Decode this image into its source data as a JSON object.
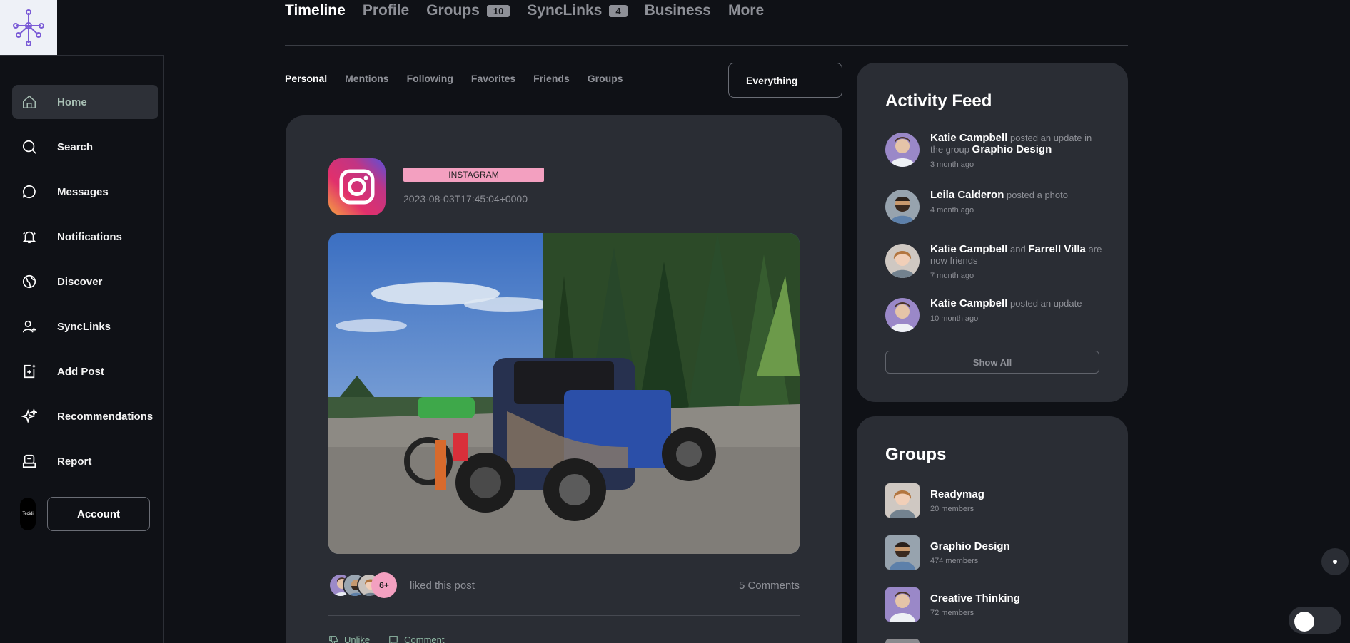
{
  "sidebar": {
    "items": [
      {
        "label": "Home",
        "icon": "home-icon"
      },
      {
        "label": "Search",
        "icon": "search-icon"
      },
      {
        "label": "Messages",
        "icon": "message-icon"
      },
      {
        "label": "Notifications",
        "icon": "bell-icon"
      },
      {
        "label": "Discover",
        "icon": "globe-icon"
      },
      {
        "label": "SyncLinks",
        "icon": "user-plus-icon"
      },
      {
        "label": "Add Post",
        "icon": "add-post-icon"
      },
      {
        "label": "Recommendations",
        "icon": "sparkle-icon"
      },
      {
        "label": "Report",
        "icon": "report-icon"
      }
    ],
    "account_label": "Account",
    "account_avatar_text": "Tecidi"
  },
  "top_tabs": [
    {
      "label": "Timeline"
    },
    {
      "label": "Profile"
    },
    {
      "label": "Groups",
      "count": "10"
    },
    {
      "label": "SyncLinks",
      "count": "4"
    },
    {
      "label": "Business"
    },
    {
      "label": "More"
    }
  ],
  "sub_tabs": [
    "Personal",
    "Mentions",
    "Following",
    "Favorites",
    "Friends",
    "Groups"
  ],
  "filter": {
    "selected": "Everything"
  },
  "post": {
    "source": "INSTAGRAM",
    "date": "2023-08-03T17:45:04+0000",
    "liked_more": "6+",
    "liked_text": "liked this post",
    "comments": "5 Comments",
    "unlike_label": "Unlike",
    "comment_label": "Comment"
  },
  "activity": {
    "title": "Activity Feed",
    "items": [
      {
        "name": "Katie Campbell",
        "text": " posted an update in the group ",
        "target": "Graphio Design",
        "time": "3 month ago"
      },
      {
        "name": "Leila Calderon",
        "text": " posted a photo",
        "target": "",
        "time": "4 month ago"
      },
      {
        "name": "Katie Campbell",
        "text": " and ",
        "target": "Farrell Villa",
        "text2": " are now friends",
        "time": "7 month ago"
      },
      {
        "name": "Katie Campbell",
        "text": " posted an update",
        "target": "",
        "time": "10 month ago"
      }
    ],
    "show_all": "Show All"
  },
  "groups": {
    "title": "Groups",
    "items": [
      {
        "name": "Readymag",
        "members": "20 members"
      },
      {
        "name": "Graphio Design",
        "members": "474 members"
      },
      {
        "name": "Creative Thinking",
        "members": "72 members"
      }
    ]
  },
  "colors": {
    "accent": "#f3a0c0",
    "card": "#2a2d34",
    "background": "#0f1116",
    "active_nav_text": "#a8bfb4"
  }
}
